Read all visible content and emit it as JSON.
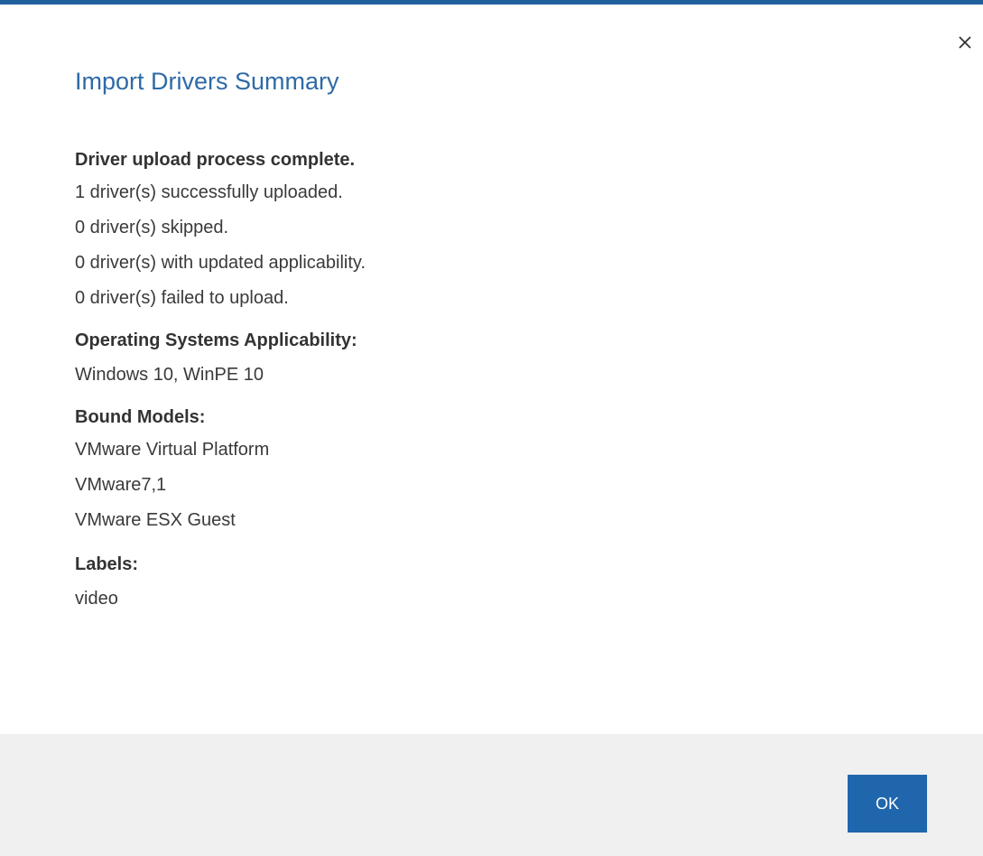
{
  "dialog": {
    "title": "Import Drivers Summary",
    "close_icon": "close-icon",
    "accent_color": "#1f5f9e",
    "title_color": "#2f6aa6"
  },
  "summary": {
    "heading": "Driver upload process complete.",
    "lines": [
      "1 driver(s) successfully uploaded.",
      "0 driver(s) skipped.",
      "0 driver(s) with updated applicability.",
      "0 driver(s) failed to upload."
    ]
  },
  "os_applicability": {
    "heading": "Operating Systems Applicability:",
    "value": "Windows 10, WinPE 10"
  },
  "bound_models": {
    "heading": "Bound Models:",
    "items": [
      "VMware Virtual Platform",
      "VMware7,1",
      "VMware ESX Guest"
    ]
  },
  "labels": {
    "heading": "Labels:",
    "value": "video"
  },
  "footer": {
    "ok_label": "OK",
    "button_color": "#1f66ad"
  }
}
